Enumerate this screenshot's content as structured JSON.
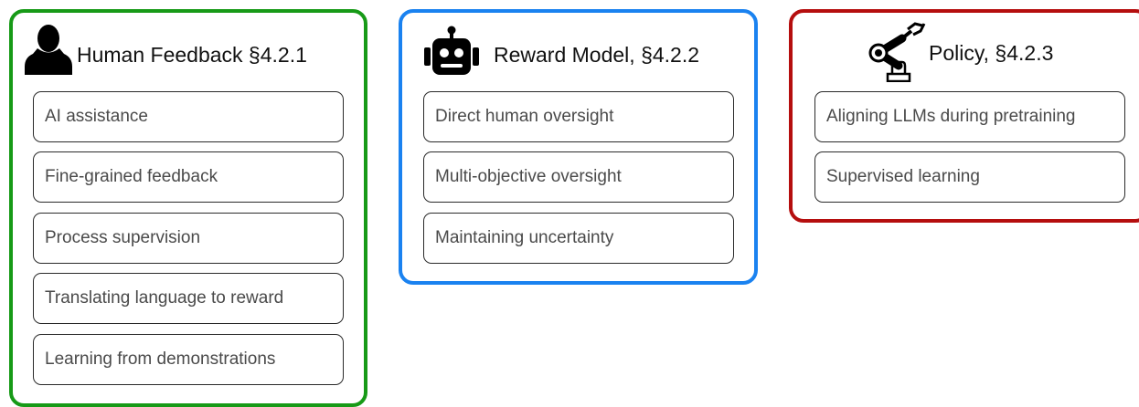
{
  "groups": [
    {
      "title": "Human Feedback §4.2.1",
      "icon": "person-silhouette-icon",
      "border_color": "#179a17",
      "items": [
        "AI assistance",
        "Fine-grained feedback",
        "Process supervision",
        "Translating language to reward",
        "Learning from demonstrations"
      ]
    },
    {
      "title": "Reward Model, §4.2.2",
      "icon": "robot-head-icon",
      "border_color": "#1a82f0",
      "items": [
        "Direct human oversight",
        "Multi-objective oversight",
        "Maintaining uncertainty"
      ]
    },
    {
      "title": "Policy, §4.2.3",
      "icon": "robotic-arm-icon",
      "border_color": "#b50e0e",
      "items": [
        "Aligning LLMs during pretraining",
        "Supervised learning"
      ]
    }
  ]
}
